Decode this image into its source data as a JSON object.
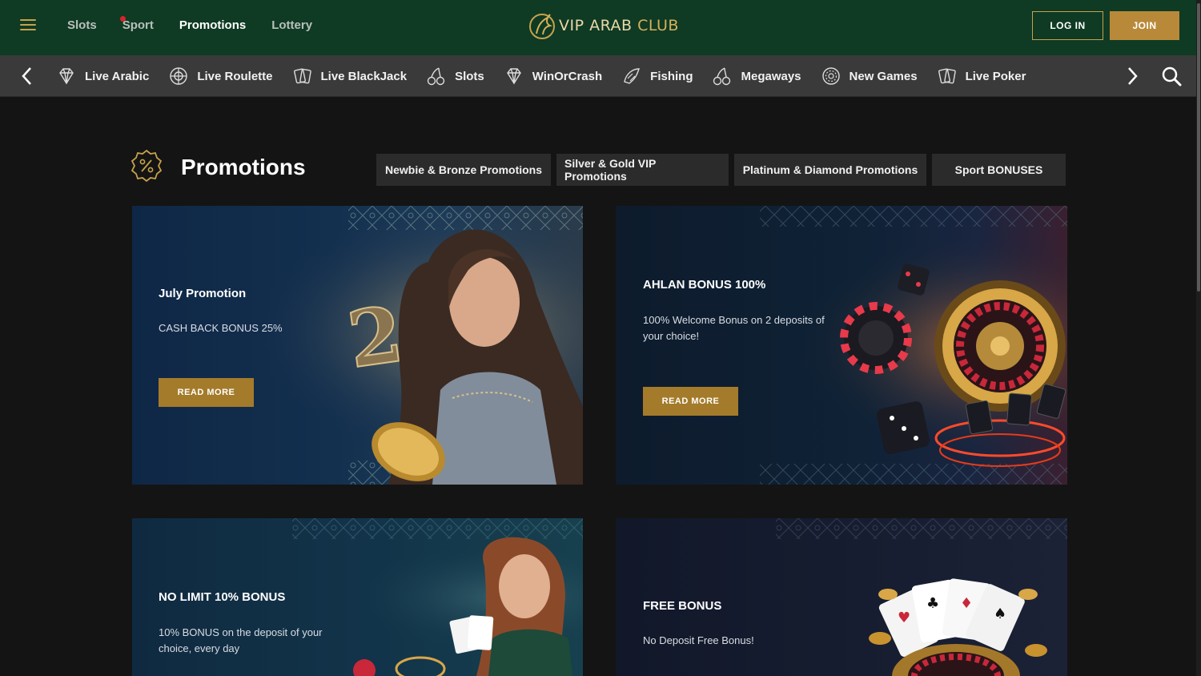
{
  "header": {
    "logo_text_a": "VIP ARAB",
    "logo_text_b": "CLUB",
    "nav": [
      {
        "label": "Slots"
      },
      {
        "label": "Sport"
      },
      {
        "label": "Promotions"
      },
      {
        "label": "Lottery"
      }
    ],
    "login_label": "LOG IN",
    "join_label": "JOIN"
  },
  "categories": [
    {
      "label": "Live Arabic",
      "icon": "diamond-icon"
    },
    {
      "label": "Live Roulette",
      "icon": "roulette-icon"
    },
    {
      "label": "Live BlackJack",
      "icon": "cards-icon"
    },
    {
      "label": "Slots",
      "icon": "cherry-icon"
    },
    {
      "label": "WinOrCrash",
      "icon": "diamond-icon"
    },
    {
      "label": "Fishing",
      "icon": "fish-icon"
    },
    {
      "label": "Megaways",
      "icon": "cherry-icon"
    },
    {
      "label": "New Games",
      "icon": "chip-icon"
    },
    {
      "label": "Live Poker",
      "icon": "cards-icon"
    }
  ],
  "promotions": {
    "title": "Promotions",
    "tabs": [
      {
        "label": "Newbie & Bronze Promotions"
      },
      {
        "label": "Silver & Gold VIP Promotions"
      },
      {
        "label": "Platinum & Diamond Promotions"
      },
      {
        "label": "Sport BONUSES"
      }
    ],
    "cards": [
      {
        "title": "July Promotion",
        "desc": "CASH BACK BONUS 25%",
        "button": "READ MORE"
      },
      {
        "title": "AHLAN BONUS 100%",
        "desc": "100% Welcome Bonus on 2 deposits of your choice!",
        "button": "READ MORE"
      },
      {
        "title": "NO LIMIT 10% BONUS",
        "desc": "10% BONUS on the deposit of your choice, every day"
      },
      {
        "title": "FREE BONUS",
        "desc": "No Deposit Free Bonus!"
      }
    ]
  },
  "colors": {
    "header_bg": "#0f3a24",
    "gold_accent": "#b9893a",
    "category_bar_bg": "#3a3a3a",
    "page_bg": "#141414"
  }
}
